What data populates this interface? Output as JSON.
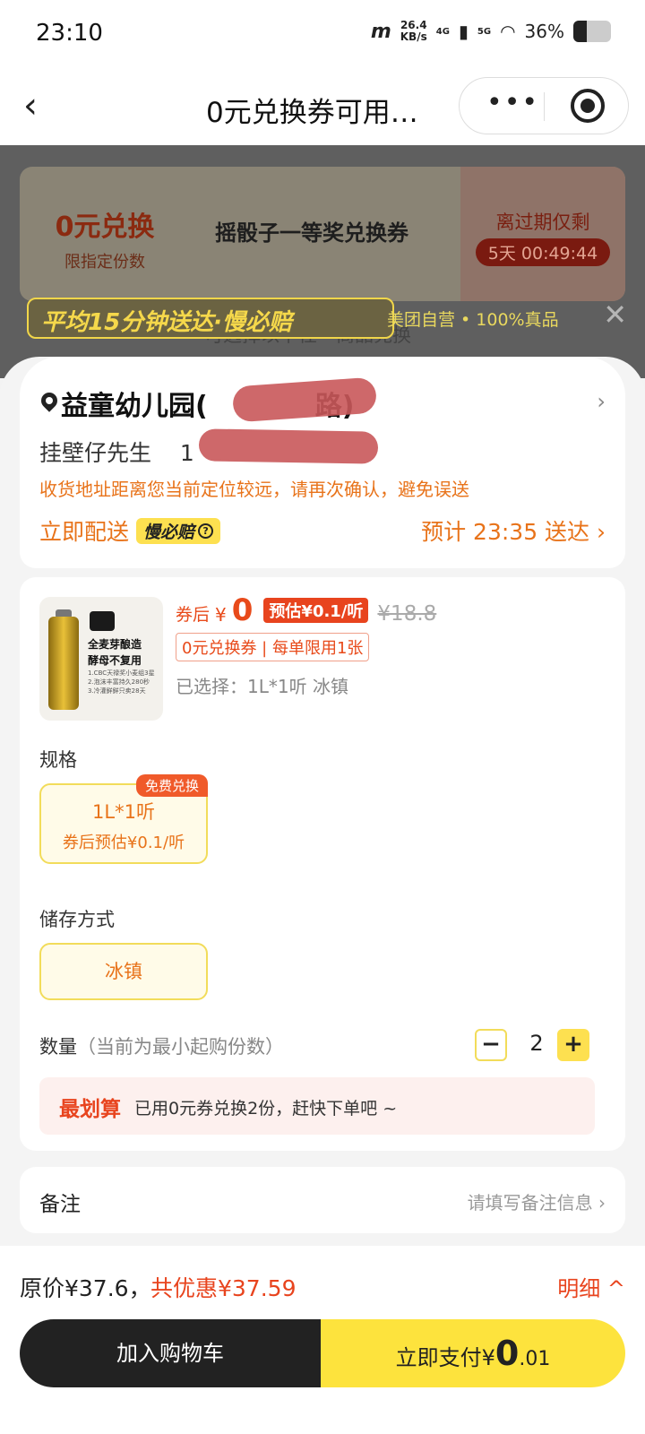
{
  "status_bar": {
    "time": "23:10",
    "net_speed": "26.4",
    "net_unit": "KB/s",
    "sig1": "4G",
    "sig2": "5G",
    "battery": "36%"
  },
  "nav": {
    "back_icon": "‹",
    "title": "0元兑换券可用…",
    "more": "•••"
  },
  "overlay": {
    "coupon_amount": "0元兑换",
    "coupon_limit": "限指定份数",
    "coupon_name": "摇骰子一等奖兑换券",
    "expire_label": "离过期仅剩",
    "expire_timer": "5天 00:49:44",
    "promo_main": "平均15分钟送达·慢必赔",
    "promo_sub": "美团自营 • 100%真品",
    "subtitle": "可选择以下任一商品兑换",
    "close_icon": "✕"
  },
  "address": {
    "name": "益童幼儿园(",
    "name_tail": "路)",
    "contact": "挂壁仔先生",
    "phone_prefix": "1",
    "warning": "收货地址距离您当前定位较远，请再次确认，避免误送",
    "deliver_now": "立即配送",
    "slow_badge": "慢必赔",
    "eta": "预计 23:35 送达 ›"
  },
  "product": {
    "img_line1": "全麦芽酿造",
    "img_line2": "酵母不复用",
    "img_tiny": "1.CBC天禄奖小麦组3星\n2.泡沫丰富持久280秒\n3.冷灌鲜鲜只卖28天",
    "price_label": "券后",
    "price_currency": "¥",
    "price_value": "0",
    "price_est": "预估¥0.1/听",
    "price_orig": "¥18.8",
    "coupon_tag": "0元兑换券 | 每单限用1张",
    "selected": "已选择：1L*1听 冰镇",
    "spec_label": "规格",
    "spec_option": "1L*1听",
    "spec_option_sub": "券后预估¥0.1/听",
    "spec_badge": "免费兑换",
    "storage_label": "储存方式",
    "storage_option": "冰镇",
    "qty_label": "数量",
    "qty_hint": "（当前为最小起购份数）",
    "qty_minus": "−",
    "qty_value": "2",
    "qty_plus": "+",
    "best_title": "最划算",
    "best_text": "已用0元券兑换2份，赶快下单吧 ~"
  },
  "note": {
    "label": "备注",
    "placeholder": "请填写备注信息 ›"
  },
  "bottom": {
    "orig": "原价¥37.6，",
    "discount": "共优惠¥37.59",
    "detail": "明细 ^",
    "cart": "加入购物车",
    "pay_label": "立即支付¥",
    "pay_big": "0",
    "pay_cents": ".01"
  }
}
